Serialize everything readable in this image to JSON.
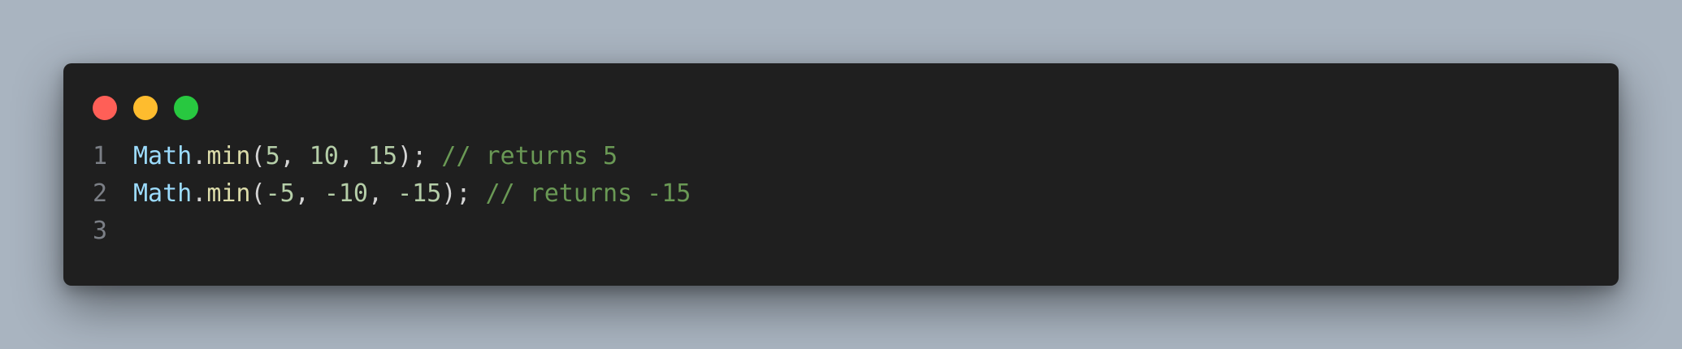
{
  "window": {
    "buttons": [
      "close",
      "minimize",
      "maximize"
    ],
    "colors": {
      "close": "#ff5f57",
      "minimize": "#febc2e",
      "maximize": "#28c840",
      "background": "#1f1f1f"
    }
  },
  "code": {
    "lines": [
      {
        "number": "1",
        "object": "Math",
        "dot": ".",
        "method": "min",
        "open": "(",
        "args": [
          {
            "value": "5",
            "sep": ", "
          },
          {
            "value": "10",
            "sep": ", "
          },
          {
            "value": "15",
            "sep": ""
          }
        ],
        "close": ");",
        "comment": " // returns 5"
      },
      {
        "number": "2",
        "object": "Math",
        "dot": ".",
        "method": "min",
        "open": "(",
        "args": [
          {
            "value": "-5",
            "sep": ", "
          },
          {
            "value": "-10",
            "sep": ", "
          },
          {
            "value": "-15",
            "sep": ""
          }
        ],
        "close": ");",
        "comment": " // returns -15"
      },
      {
        "number": "3"
      }
    ]
  }
}
